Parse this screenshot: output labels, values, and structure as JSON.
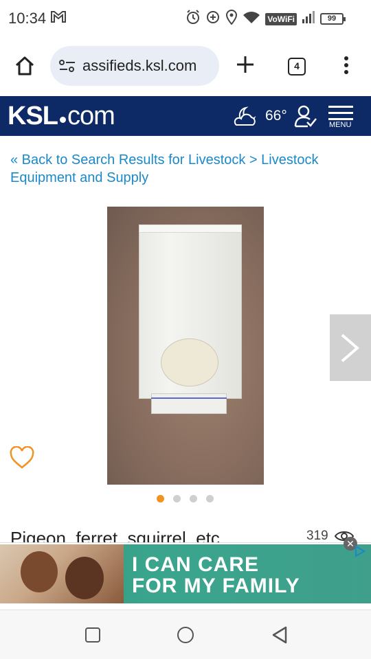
{
  "status": {
    "time": "10:34",
    "vowifi": "VoWiFi",
    "battery": "99"
  },
  "browser": {
    "url": "assifieds.ksl.com",
    "tab_count": "4"
  },
  "header": {
    "logo_main": "KSL",
    "logo_suffix": "com",
    "temperature": "66°",
    "menu_label": "MENU",
    "brand_color": "#0d2a66"
  },
  "breadcrumb": {
    "back_link": "« Back to Search Results for Livestock",
    "separator": " > ",
    "category_link": "Livestock Equipment and Supply"
  },
  "gallery": {
    "image_count": 4,
    "active_index": 0,
    "active_color": "#f2931f"
  },
  "listing": {
    "title": "Pigeon, ferret, squirrel, etc",
    "views": "319"
  },
  "ad": {
    "line1": "I CAN CARE",
    "line2": "FOR MY FAMILY",
    "close_label": "✕"
  }
}
